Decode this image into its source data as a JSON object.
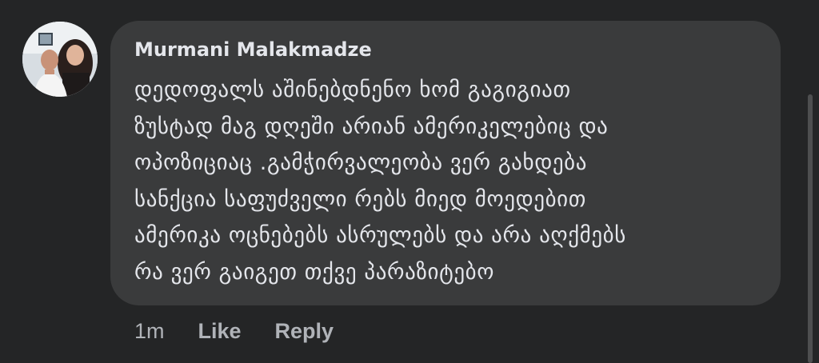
{
  "comment": {
    "author": "Murmani Malakmadze",
    "lines": [
      "დედოფალს აშინებდნენო ხომ გაგიგიათ",
      "ზუსტად მაგ დღეში არიან ამერიკელებიც და",
      "ოპოზიციაც .გამჭირვალეობა ვერ გახდება",
      "სანქცია საფუძველი რებს მიედ მოედებით",
      "ამერიკა ოცნებებს ასრულებს და არა აღქმებს",
      "რა ვერ გაიგეთ თქვე პარაზიტებო"
    ],
    "timestamp": "1m",
    "like_label": "Like",
    "reply_label": "Reply"
  },
  "colors": {
    "background": "#242526",
    "bubble": "#3a3b3c",
    "primary_text": "#e4e6eb",
    "secondary_text": "#b0b3b8"
  }
}
